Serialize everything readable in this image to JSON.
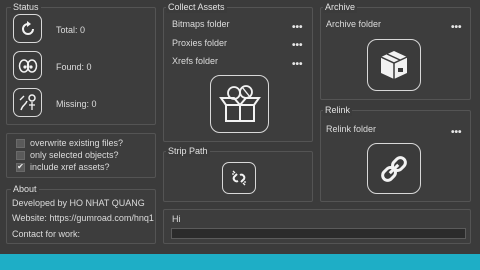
{
  "status": {
    "title": "Status",
    "total_label": "Total: 0",
    "found_label": "Found: 0",
    "missing_label": "Missing: 0"
  },
  "collect": {
    "title": "Collect Assets",
    "bitmaps_label": "Bitmaps folder",
    "proxies_label": "Proxies folder",
    "xrefs_label": "Xrefs folder",
    "dots": "•••"
  },
  "archive": {
    "title": "Archive",
    "folder_label": "Archive folder",
    "dots": "•••"
  },
  "relink": {
    "title": "Relink",
    "folder_label": "Relink folder",
    "dots": "•••"
  },
  "options": {
    "overwrite": "overwrite existing files?",
    "selected_only": "only selected objects?",
    "include_xref": "include xref assets?",
    "overwrite_checked": false,
    "selected_checked": false,
    "include_xref_checked": true,
    "check_mark": "✔"
  },
  "strip": {
    "title": "Strip Path"
  },
  "about": {
    "title": "About",
    "developer": "Developed by HO NHAT QUANG",
    "website": "Website: https://gumroad.com/hnq1",
    "contact": "Contact for work:"
  },
  "log": {
    "label": "Hi",
    "value": ""
  },
  "banner": {
    "text": ""
  },
  "colors": {
    "banner": "#1eaec6",
    "panel_bg": "#3b3b3b",
    "border": "#545454"
  }
}
